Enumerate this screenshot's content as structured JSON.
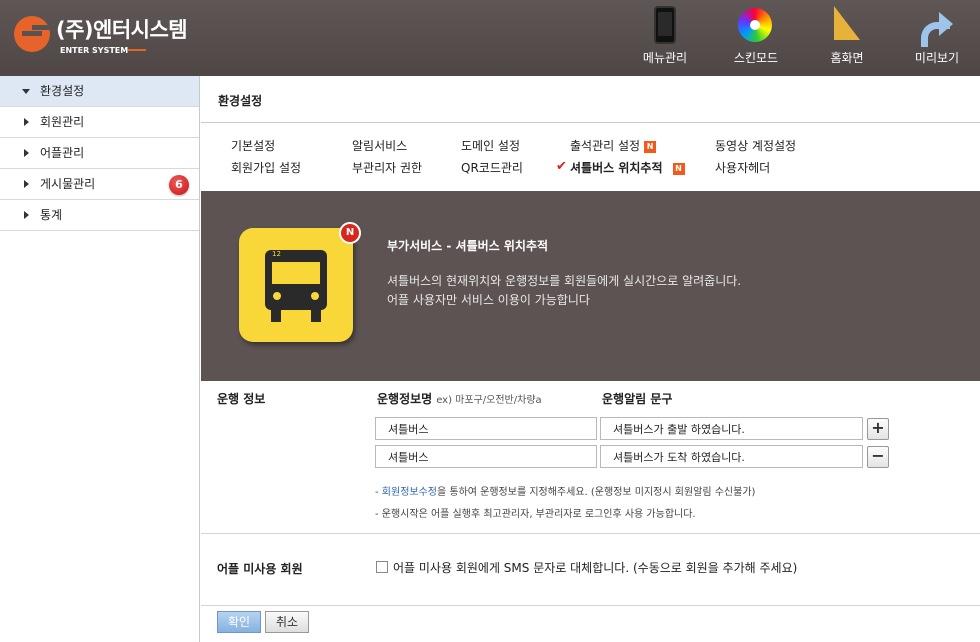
{
  "header": {
    "logo_title": "(주)엔터시스템",
    "logo_sub": "ENTER SYSTEM",
    "tools": [
      {
        "label": "메뉴관리",
        "icon": "phone-icon"
      },
      {
        "label": "스킨모드",
        "icon": "color-wheel-icon"
      },
      {
        "label": "홈화면",
        "icon": "ruler-triangle-icon"
      },
      {
        "label": "미리보기",
        "icon": "arrow-forward-icon"
      }
    ]
  },
  "sidebar": {
    "items": [
      {
        "label": "환경설정",
        "active": true
      },
      {
        "label": "회원관리"
      },
      {
        "label": "어플관리"
      },
      {
        "label": "게시물관리",
        "badge": "6"
      },
      {
        "label": "통계"
      }
    ]
  },
  "main": {
    "title": "환경설정",
    "tabs": [
      "기본설정",
      "알림서비스",
      "도메인 설정",
      "출석관리 설정",
      "동영상 계정설정",
      "회원가입 설정",
      "부관리자 권한",
      "QR코드관리",
      "셔틀버스 위치추적",
      "사용자헤더"
    ],
    "new_badge": "N",
    "banner": {
      "app_number": "12",
      "new_mark": "N",
      "title": "부가서비스 - 셔틀버스 위치추적",
      "desc1": "셔틀버스의 현재위치와 운행정보를 회원들에게 실시간으로 알려줍니다.",
      "desc2": "어플 사용자만 서비스 이용이 가능합니다"
    },
    "run_info": {
      "label": "운행 정보",
      "col1_title": "운행정보명",
      "col1_hint": "ex) 마포구/오전반/차량a",
      "col2_title": "운행알림 문구",
      "rows": [
        {
          "name": "셔틀버스",
          "message": "셔틀버스가 출발 하였습니다.",
          "button": "+"
        },
        {
          "name": "셔틀버스",
          "message": "셔틀버스가 도착 하였습니다.",
          "button": "−"
        }
      ],
      "note1_prefix": "- ",
      "note1_link": "회원정보수정",
      "note1_suffix": "을 통하여 운행정보를 지정해주세요. (운행정보 미지정시 회원알림 수신불가)",
      "note2": "- 운행시작은 어플 실행후 최고관리자, 부관리자로 로그인후 사용 가능합니다."
    },
    "non_app": {
      "label": "어플 미사용 회원",
      "checkbox_text": "어플 미사용 회원에게 SMS 문자로 대체합니다. (수동으로 회원을 추가해 주세요)",
      "checked": false
    },
    "buttons": {
      "confirm": "확인",
      "cancel": "취소"
    }
  }
}
